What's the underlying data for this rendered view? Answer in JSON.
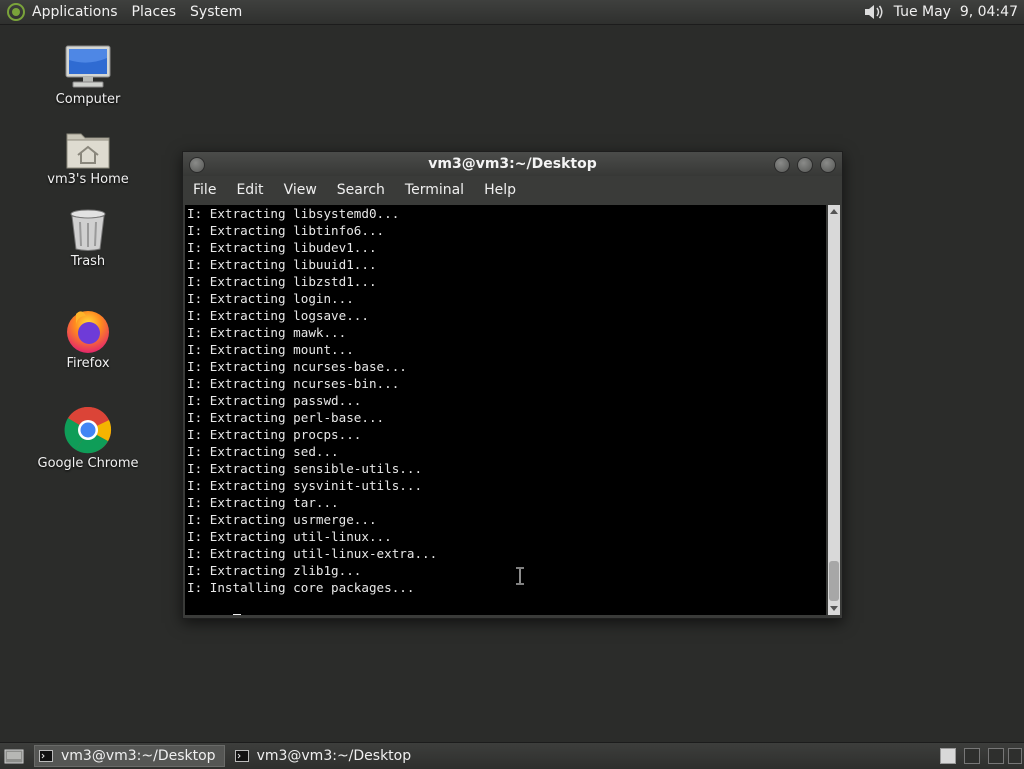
{
  "top_panel": {
    "menus": [
      "Applications",
      "Places",
      "System"
    ],
    "clock": "Tue May  9, 04:47",
    "icons": {
      "logo": "distro-logo-icon",
      "volume": "volume-icon"
    }
  },
  "desktop": {
    "icons": [
      {
        "label": "Computer",
        "icon": "computer-icon"
      },
      {
        "label": "vm3's Home",
        "icon": "home-folder-icon"
      },
      {
        "label": "Trash",
        "icon": "trash-icon"
      },
      {
        "label": "Firefox",
        "icon": "firefox-icon"
      },
      {
        "label": "Google Chrome",
        "icon": "chrome-icon"
      }
    ]
  },
  "window": {
    "title": "vm3@vm3:~/Desktop",
    "menus": [
      "File",
      "Edit",
      "View",
      "Search",
      "Terminal",
      "Help"
    ],
    "lines": [
      "I: Extracting libsystemd0...",
      "I: Extracting libtinfo6...",
      "I: Extracting libudev1...",
      "I: Extracting libuuid1...",
      "I: Extracting libzstd1...",
      "I: Extracting login...",
      "I: Extracting logsave...",
      "I: Extracting mawk...",
      "I: Extracting mount...",
      "I: Extracting ncurses-base...",
      "I: Extracting ncurses-bin...",
      "I: Extracting passwd...",
      "I: Extracting perl-base...",
      "I: Extracting procps...",
      "I: Extracting sed...",
      "I: Extracting sensible-utils...",
      "I: Extracting sysvinit-utils...",
      "I: Extracting tar...",
      "I: Extracting usrmerge...",
      "I: Extracting util-linux...",
      "I: Extracting util-linux-extra...",
      "I: Extracting zlib1g...",
      "I: Installing core packages..."
    ]
  },
  "taskbar": {
    "tasks": [
      {
        "label": "vm3@vm3:~/Desktop",
        "active": true
      },
      {
        "label": "vm3@vm3:~/Desktop",
        "active": false
      }
    ],
    "icons": {
      "show_desktop": "show-desktop-icon",
      "task": "terminal-icon"
    }
  }
}
